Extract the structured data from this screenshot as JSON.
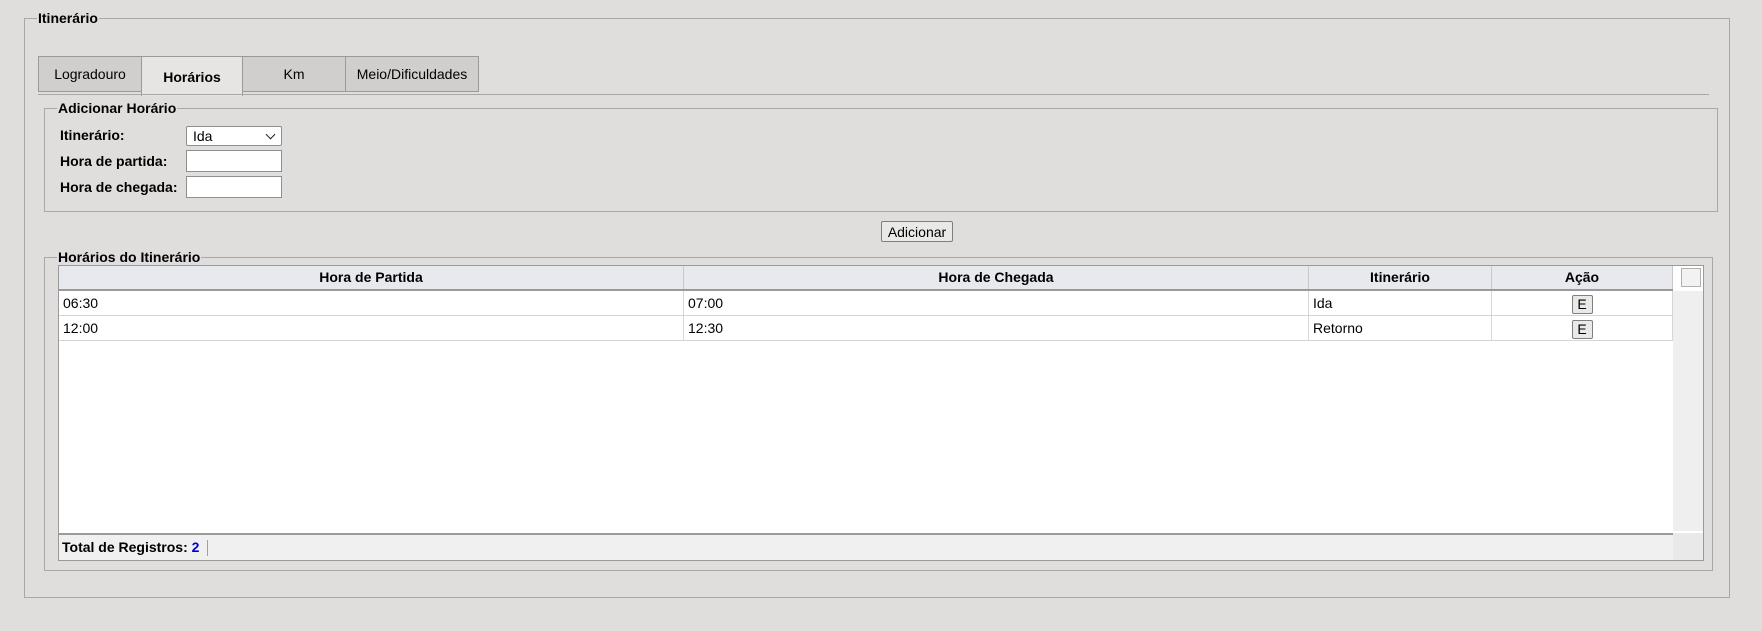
{
  "main": {
    "legend": "Itinerário"
  },
  "tabs": [
    {
      "label": "Logradouro",
      "active": false
    },
    {
      "label": "Horários",
      "active": true
    },
    {
      "label": "Km",
      "active": false
    },
    {
      "label": "Meio/Dificuldades",
      "active": false
    }
  ],
  "add_form": {
    "legend": "Adicionar Horário",
    "itinerario_label": "Itinerário:",
    "itinerario_value": "Ida",
    "partida_label": "Hora de partida:",
    "partida_value": "",
    "chegada_label": "Hora de chegada:",
    "chegada_value": "",
    "add_button": "Adicionar"
  },
  "list": {
    "legend": "Horários do Itinerário",
    "columns": [
      "Hora de Partida",
      "Hora de Chegada",
      "Itinerário",
      "Ação"
    ],
    "rows": [
      {
        "partida": "06:30",
        "chegada": "07:00",
        "itinerario": "Ida",
        "acao": "E"
      },
      {
        "partida": "12:00",
        "chegada": "12:30",
        "itinerario": "Retorno",
        "acao": "E"
      }
    ],
    "total_label": "Total de Registros:",
    "total_value": "2"
  }
}
